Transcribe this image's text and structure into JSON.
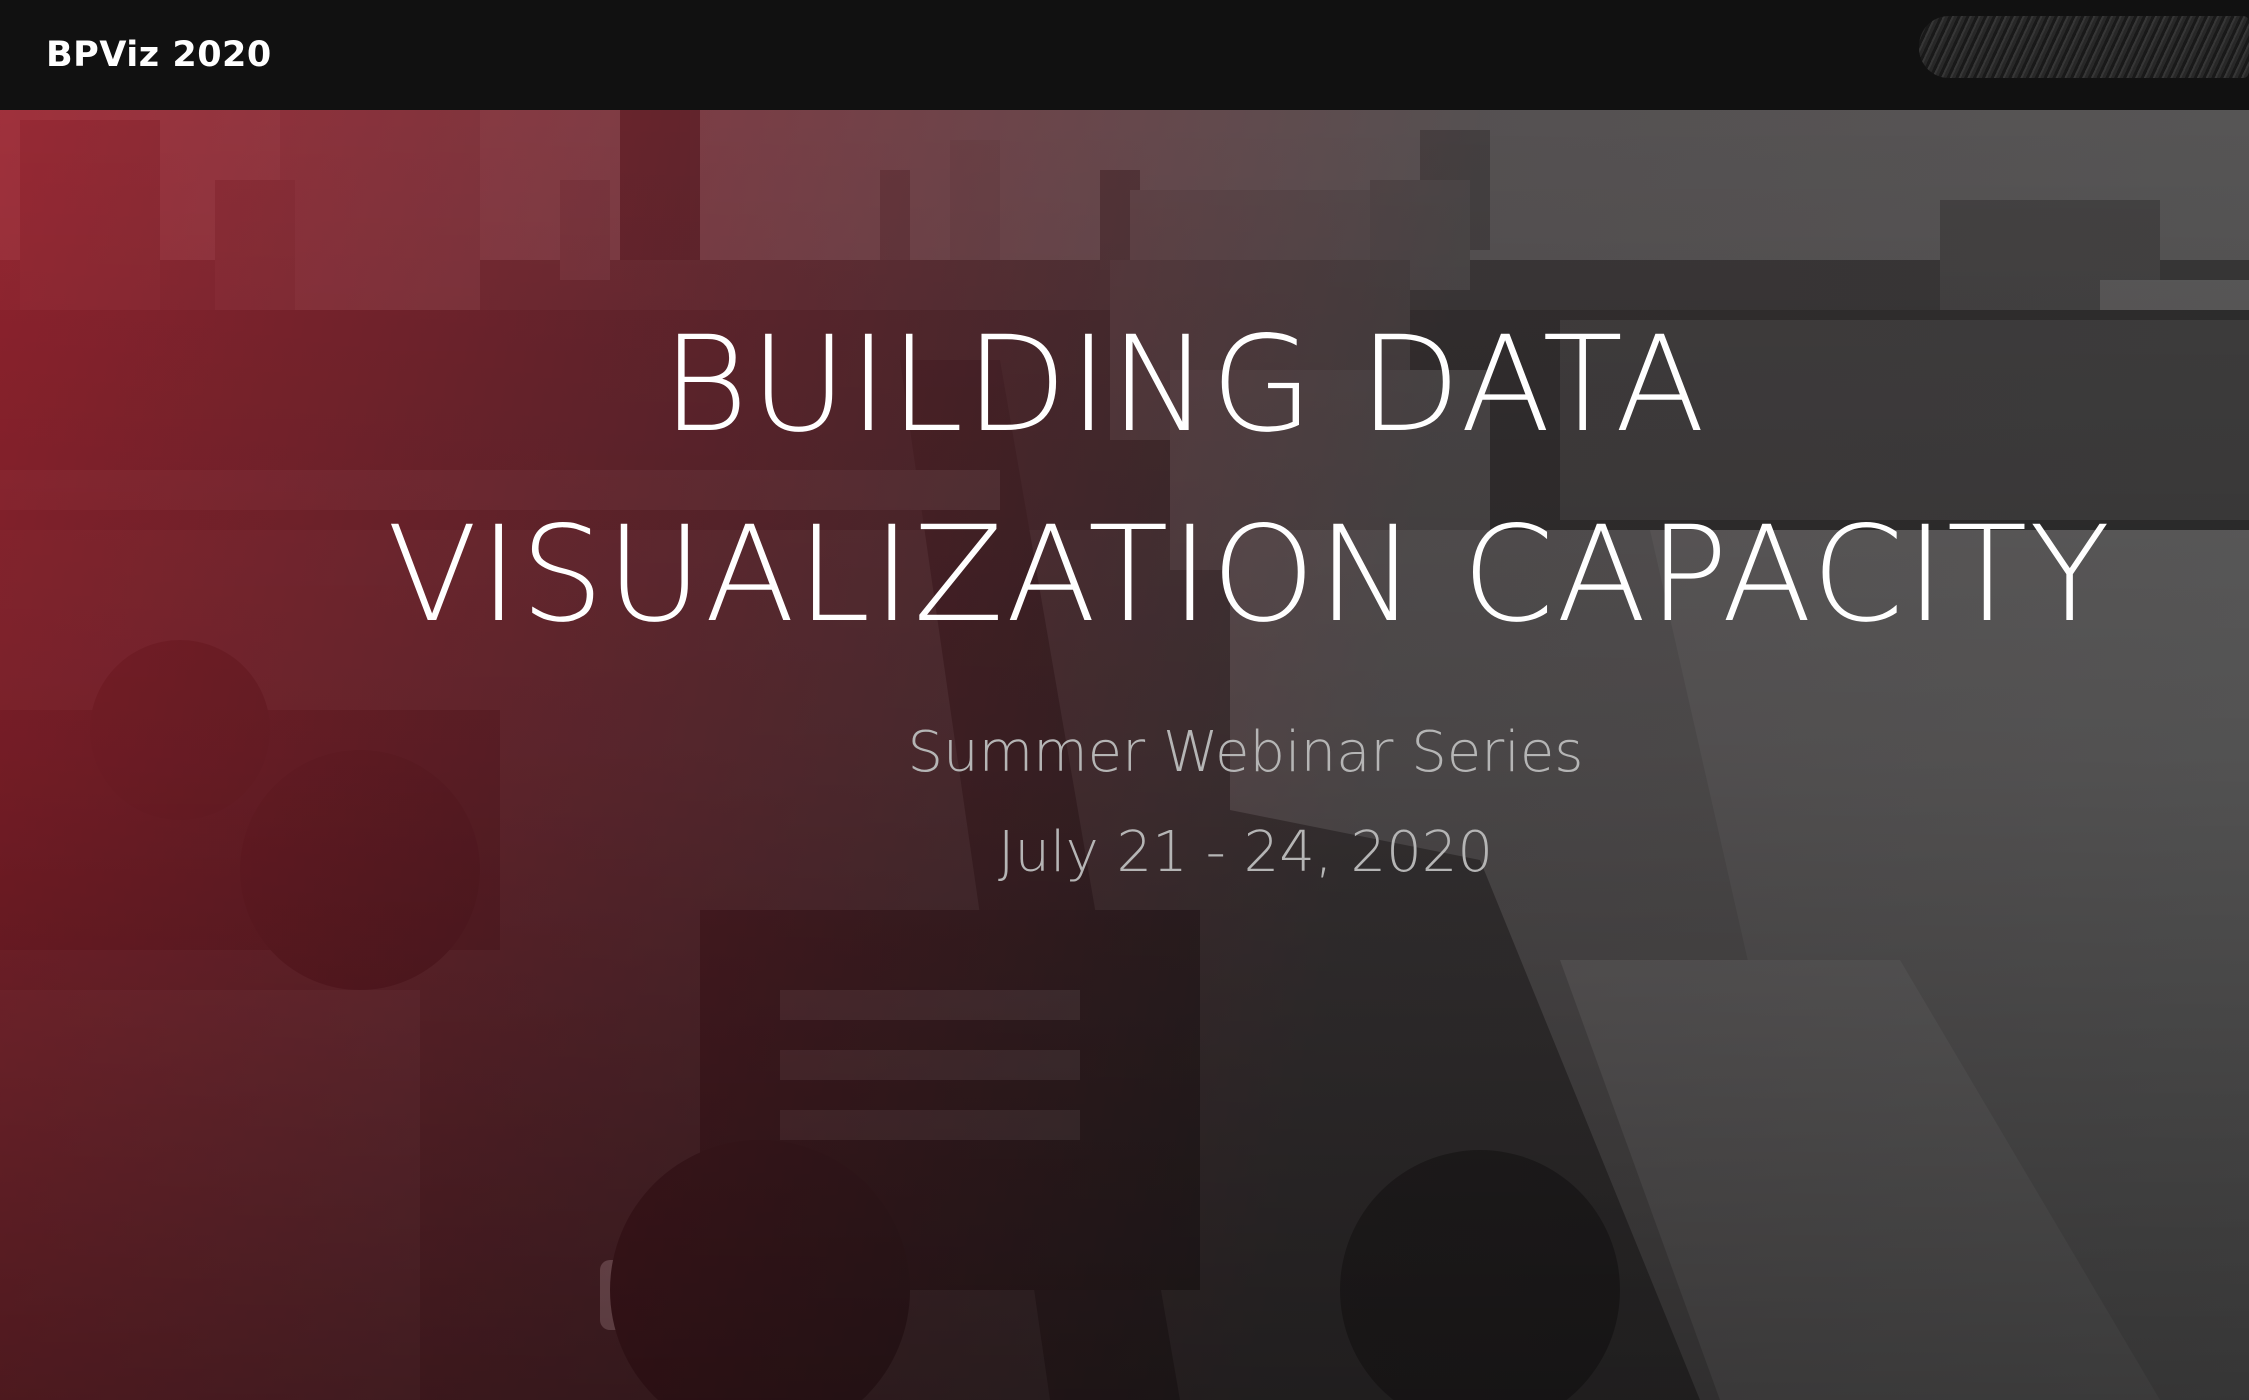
{
  "nav": {
    "brand": "BPViz 2020"
  },
  "hero": {
    "title_line1": "BUILDING DATA",
    "title_line2": "VISUALIZATION CAPACITY",
    "subtitle": "Summer Webinar Series",
    "dates": "July 21 - 24, 2020"
  },
  "colors": {
    "navbar": "#111111",
    "overlay_red": "#aa1c2a",
    "subtitle_gray": "#b5b5b5"
  }
}
